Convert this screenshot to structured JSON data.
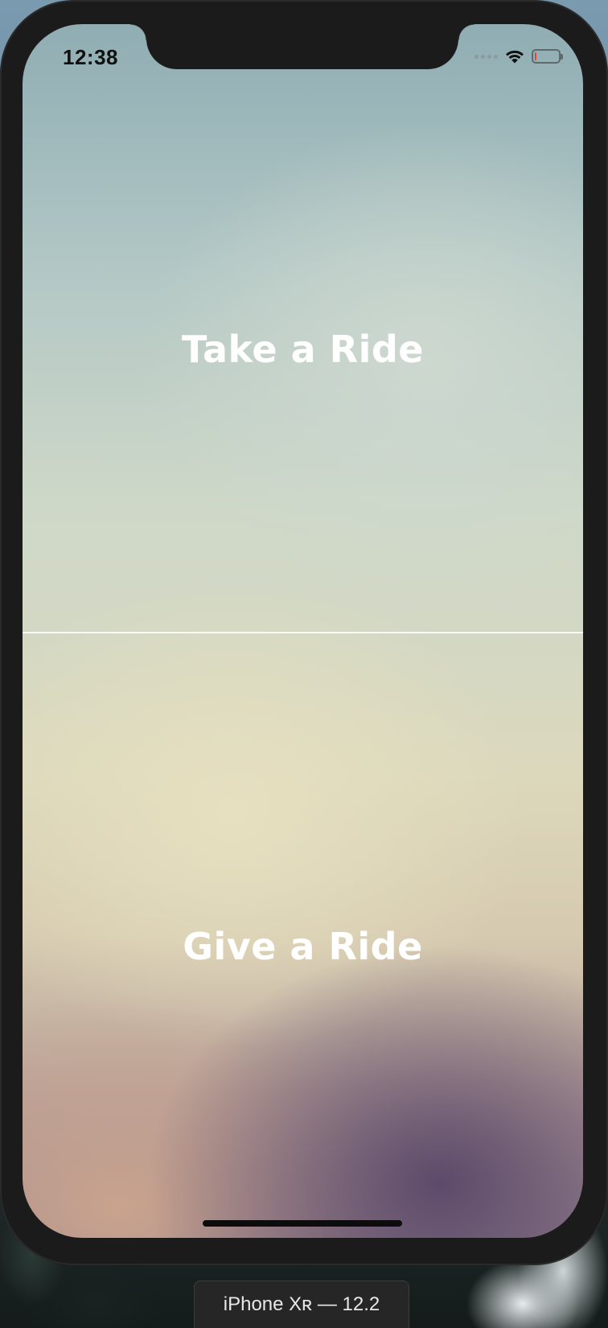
{
  "status_bar": {
    "time": "12:38",
    "icons": [
      "signal-dots-icon",
      "wifi-icon",
      "battery-icon"
    ],
    "battery_level": 0.05,
    "battery_color": "#e0443c"
  },
  "options": {
    "take_ride_label": "Take a Ride",
    "give_ride_label": "Give a Ride"
  },
  "simulator": {
    "device_label": "iPhone Xʀ — 12.2"
  },
  "colors": {
    "label_text": "#ffffff",
    "divider": "#ffffff",
    "device_frame": "#1b1b1c"
  }
}
